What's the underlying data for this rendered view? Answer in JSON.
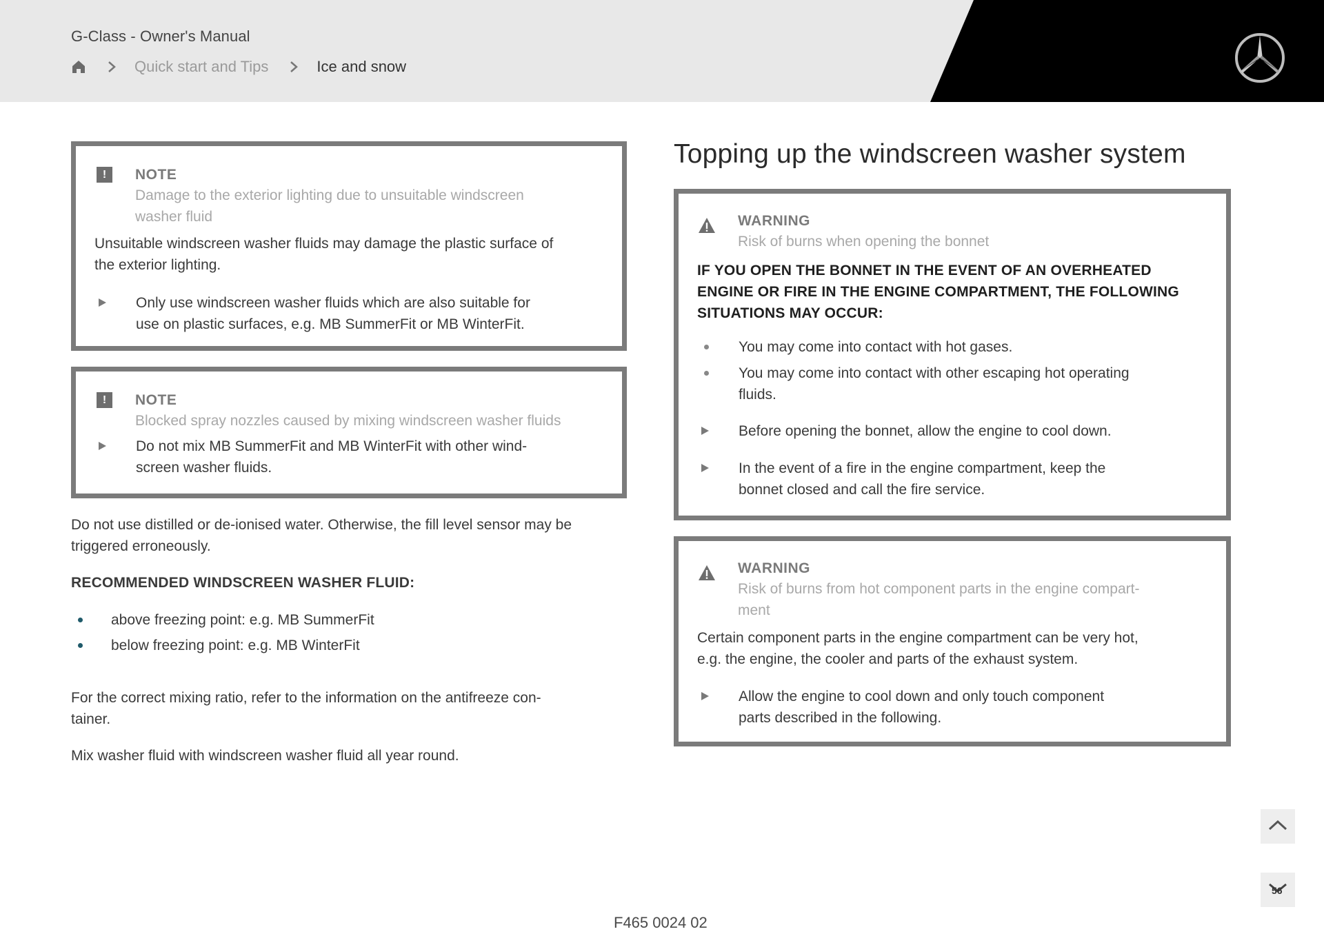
{
  "header": {
    "manual_title": "G-Class - Owner's Manual",
    "breadcrumb": {
      "home_icon": "home-icon",
      "items": [
        {
          "label": "Quick start and Tips"
        },
        {
          "label": "Ice and snow"
        }
      ]
    },
    "logo": "mercedes-star-logo"
  },
  "left": {
    "note1": {
      "kind": "NOTE",
      "subtitle_line1": "Damage to the exterior lighting due to unsuitable windscreen",
      "subtitle_line2": "washer fluid",
      "body_line1": "Unsuitable windscreen washer fluids may damage the plastic surface of",
      "body_line2": "the exterior lighting.",
      "action_line1": "Only use windscreen washer fluids which are also suitable for",
      "action_line2": "use on plastic surfaces, e.g. MB SummerFit or MB WinterFit."
    },
    "note2": {
      "kind": "NOTE",
      "subtitle": "Blocked spray nozzles caused by mixing windscreen washer fluids",
      "action_line1": "Do not mix MB SummerFit and MB WinterFit with other wind-",
      "action_line2": "screen washer fluids."
    },
    "para1_line1": "Do not use distilled or de-ionised water. Otherwise, the fill level sensor may be",
    "para1_line2": "triggered erroneously.",
    "recommended_heading": "RECOMMENDED WINDSCREEN WASHER FLUID:",
    "recommended_items": [
      "above freezing point: e.g. MB SummerFit",
      "below freezing point: e.g. MB WinterFit"
    ],
    "para2_line1": "For the correct mixing ratio, refer to the information on the antifreeze con-",
    "para2_line2": "tainer.",
    "para3": "Mix washer fluid with windscreen washer fluid all year round."
  },
  "right": {
    "heading": "Topping up the windscreen washer system",
    "warning1": {
      "kind": "WARNING",
      "subtitle": "Risk of burns when opening the bonnet",
      "caps_line1": "IF YOU OPEN THE BONNET IN THE EVENT OF AN OVERHEATED",
      "caps_line2": "ENGINE OR FIRE IN THE ENGINE COMPARTMENT, THE FOLLOWING",
      "caps_line3": "SITUATIONS MAY OCCUR:",
      "bullet1": "You may come into contact with hot gases.",
      "bullet2_line1": "You may come into contact with other escaping hot operating",
      "bullet2_line2": "fluids.",
      "action1": "Before opening the bonnet, allow the engine to cool down.",
      "action2_line1": "In the event of a fire in the engine compartment, keep the",
      "action2_line2": "bonnet closed and call the fire service."
    },
    "warning2": {
      "kind": "WARNING",
      "subtitle_line1": "Risk of burns from hot component parts in the engine compart-",
      "subtitle_line2": "ment",
      "body_line1": "Certain component parts in the engine compartment can be very hot,",
      "body_line2": "e.g. the engine, the cooler and parts of the exhaust system.",
      "action_line1": "Allow the engine to cool down and only touch component",
      "action_line2": "parts described in the following."
    }
  },
  "nav": {
    "scroll_up_icon": "chevron-up-icon",
    "scroll_down_icon": "chevron-down-icon",
    "page_number": "56"
  },
  "footer": {
    "image_code": "F465 0024 02"
  },
  "colors": {
    "header_bg": "#e8e8e8",
    "header_black": "#000000",
    "box_border": "#7b7b7b",
    "bullet_teal": "#1f5a6a"
  }
}
